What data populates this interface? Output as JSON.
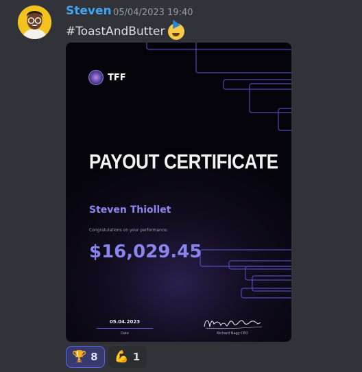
{
  "message": {
    "author": "Steven",
    "timestamp": "05/04/2023 19:40",
    "text": "#ToastAndButter",
    "emoji": "partying-face"
  },
  "certificate": {
    "logo_text": "TFF",
    "title": "PAYOUT CERTIFICATE",
    "recipient_name": "Steven Thiollet",
    "congrats_text": "Congratulations on your performance:",
    "amount": "$16,029.45",
    "date": "05.04.2023",
    "date_label": "Date",
    "signature": "Nagy Richard",
    "signature_label": "Richard Nagy CEO",
    "accent_color": "#8a84ef"
  },
  "reactions": [
    {
      "icon": "trophy-icon",
      "emoji": "🏆",
      "count": "8",
      "active": true
    },
    {
      "icon": "flexed-biceps-icon",
      "emoji": "💪",
      "count": "1",
      "active": false
    }
  ],
  "colors": {
    "background": "#313338",
    "author": "#3da5f4",
    "timestamp": "#949ba4",
    "reaction_active_border": "#5865f2"
  }
}
